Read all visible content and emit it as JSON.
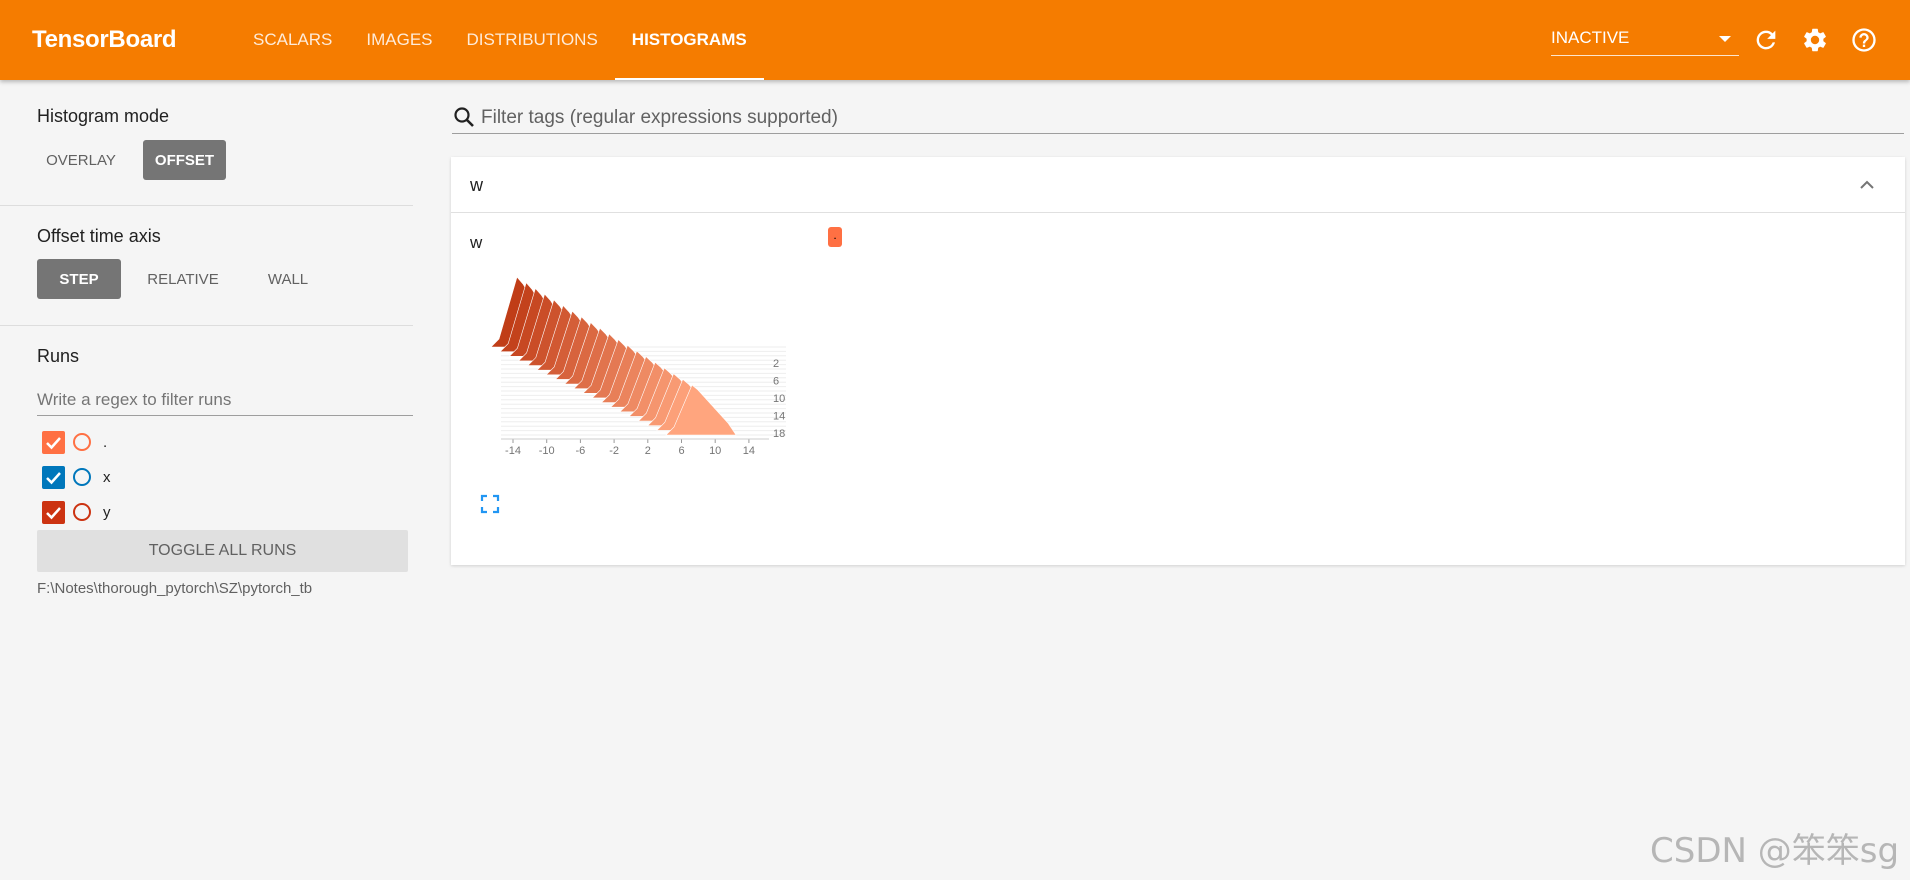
{
  "app": {
    "title": "TensorBoard"
  },
  "nav": {
    "tabs": [
      {
        "label": "SCALARS",
        "active": false
      },
      {
        "label": "IMAGES",
        "active": false
      },
      {
        "label": "DISTRIBUTIONS",
        "active": false
      },
      {
        "label": "HISTOGRAMS",
        "active": true
      }
    ],
    "inactive_select": "INACTIVE",
    "icons": [
      "refresh-icon",
      "settings-icon",
      "help-icon"
    ]
  },
  "sidebar": {
    "histogram_mode": {
      "title": "Histogram mode",
      "options": [
        "OVERLAY",
        "OFFSET"
      ],
      "selected": "OFFSET"
    },
    "offset_time_axis": {
      "title": "Offset time axis",
      "options": [
        "STEP",
        "RELATIVE",
        "WALL"
      ],
      "selected": "STEP"
    },
    "runs": {
      "title": "Runs",
      "filter_placeholder": "Write a regex to filter runs",
      "items": [
        {
          "label": ".",
          "checked": true,
          "color": "#ff7043"
        },
        {
          "label": "x",
          "checked": true,
          "color": "#0077bb"
        },
        {
          "label": "y",
          "checked": true,
          "color": "#cc3311"
        }
      ],
      "toggle_all_label": "TOGGLE ALL RUNS",
      "logdir": "F:\\Notes\\thorough_pytorch\\SZ\\pytorch_tb"
    }
  },
  "main": {
    "filter_placeholder": "Filter tags (regular expressions supported)",
    "pane": {
      "name": "w",
      "card_title": "w",
      "run_chip": "."
    }
  },
  "chart_data": {
    "type": "area",
    "mode": "offset",
    "x_ticks": [
      -14,
      -10,
      -6,
      -2,
      2,
      6,
      10,
      14
    ],
    "y_ticks": [
      2,
      6,
      10,
      14,
      18
    ],
    "xlim": [
      -16,
      14
    ],
    "steps": 20,
    "colors": {
      "near": "#c03d17",
      "far": "#ffa57e"
    }
  },
  "watermark": "CSDN @笨笨sg",
  "colors": {
    "accent": "#f57c00",
    "selected_button": "#757575"
  }
}
